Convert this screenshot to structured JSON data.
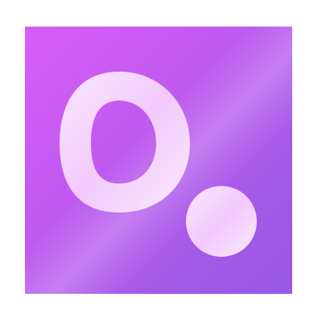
{
  "app_icon": {
    "name": "letter-o-with-dot",
    "letter": "O",
    "colors": {
      "background_start": "#d85cf6",
      "background_end": "#9b57e6",
      "glyph_light": "#fbe8ff",
      "glyph_mid": "#efc2fb"
    }
  }
}
